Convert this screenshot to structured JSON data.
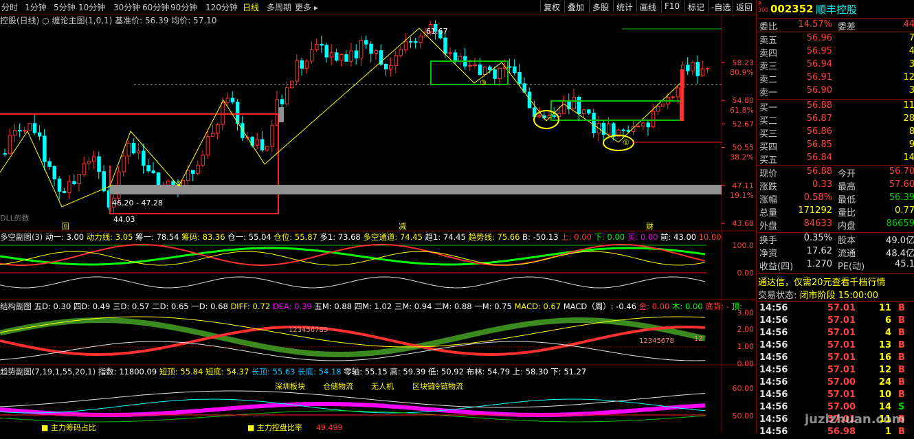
{
  "periods": [
    "分时",
    "1分钟",
    "5分钟",
    "10分钟",
    "30分钟",
    "60分钟",
    "90分钟",
    "120分钟",
    "日线",
    "多周期",
    "更多"
  ],
  "active_period": "日线",
  "toolbar": [
    "复权",
    "叠加",
    "多股",
    "统计",
    "画线",
    "F10",
    "标记",
    "-自选",
    "返回"
  ],
  "main_header": {
    "name": "控股(日线)",
    "indicator": "缠论主图(1,0,1)",
    "base_price": "基准价: 56.39",
    "avg_price": "均价: 57.10"
  },
  "price_axis": [
    {
      "price": "58.23",
      "pct": "80.9%"
    },
    {
      "price": "54.80",
      "pct": "61.8%"
    },
    {
      "price": "52.67",
      "pct": ""
    },
    {
      "price": "50.55",
      "pct": "38.2%"
    },
    {
      "price": "47.11",
      "pct": "19.1%"
    },
    {
      "price": "43.68",
      "pct": ""
    }
  ],
  "annotations": {
    "peak": "61.67",
    "low": "44.03",
    "zone": "46.20 - 47.28",
    "tag1": "回",
    "tag2": "减",
    "tag3": "财",
    "dll": "DLL的数",
    "pivot2": "②",
    "pivot3": "③",
    "pivot1": "①"
  },
  "sub1": {
    "title": "多空副图(3)",
    "values": [
      {
        "k": "动一",
        "v": "3.00",
        "c": "#ffffff"
      },
      {
        "k": "动力线",
        "v": "3.05",
        "c": "#ffff00"
      },
      {
        "k": "筹一",
        "v": "78.54",
        "c": "#ffffff"
      },
      {
        "k": "筹码",
        "v": "83.36",
        "c": "#ffff00"
      },
      {
        "k": "仓一",
        "v": "55.04",
        "c": "#ffffff"
      },
      {
        "k": "仓位",
        "v": "55.87",
        "c": "#ffff00"
      },
      {
        "k": "多1",
        "v": "73.68",
        "c": "#ffffff"
      },
      {
        "k": "多空通道",
        "v": "74.45",
        "c": "#ffff00"
      },
      {
        "k": "趋1",
        "v": "74.45",
        "c": "#ffffff"
      },
      {
        "k": "趋势线",
        "v": "75.66",
        "c": "#ffff00"
      },
      {
        "k": "B",
        "v": "-50.13",
        "c": "#ffffff"
      },
      {
        "k": "上",
        "v": "0.00",
        "c": "#ff4040"
      },
      {
        "k": "下",
        "v": "0.00",
        "c": "#00ff00"
      },
      {
        "k": "买",
        "v": "0.00",
        "c": "#ff00ff"
      },
      {
        "k": "前",
        "v": "43.00",
        "c": "#ffffff"
      },
      {
        "k": "",
        "v": "10.00",
        "c": "#ff4040"
      }
    ],
    "axis": [
      "100.0",
      "0.00"
    ]
  },
  "sub2": {
    "title": "结构副图",
    "values": [
      {
        "k": "五D",
        "v": "0.30",
        "c": "#ffffff"
      },
      {
        "k": "四D",
        "v": "0.49",
        "c": "#ffffff"
      },
      {
        "k": "三D",
        "v": "0.57",
        "c": "#ffffff"
      },
      {
        "k": "二D",
        "v": "0.65",
        "c": "#ffffff"
      },
      {
        "k": "一D",
        "v": "0.68",
        "c": "#ffffff"
      },
      {
        "k": "DIFF",
        "v": "0.72",
        "c": "#ffff00"
      },
      {
        "k": "DEA",
        "v": "0.39",
        "c": "#ff00ff"
      },
      {
        "k": "五M",
        "v": "0.88",
        "c": "#ffffff"
      },
      {
        "k": "四M",
        "v": "1.02",
        "c": "#ffffff"
      },
      {
        "k": "三M",
        "v": "0.94",
        "c": "#ffffff"
      },
      {
        "k": "二M",
        "v": "0.88",
        "c": "#ffffff"
      },
      {
        "k": "一M",
        "v": "0.75",
        "c": "#ffffff"
      },
      {
        "k": "MACD",
        "v": "0.67",
        "c": "#ffff00"
      },
      {
        "k": "MACD（周）",
        "v": "-0.46",
        "c": "#ffffff"
      },
      {
        "k": "金",
        "v": "0.00",
        "c": "#ff4040"
      },
      {
        "k": "木",
        "v": "0.00",
        "c": "#00ff00"
      },
      {
        "k": "底背",
        "v": "-",
        "c": "#ff4040"
      },
      {
        "k": "顶",
        "v": "",
        "c": "#00ff00"
      }
    ],
    "axis": [
      "3.00",
      "2.00",
      "1.00",
      "0.00"
    ],
    "seq1": "123456789",
    "seq2": "12345678",
    "seq3": "12"
  },
  "sub3": {
    "title": "趋势副图(7,19,1,55,20,1)",
    "values": [
      {
        "k": "指数",
        "v": "11800.09",
        "c": "#ffffff"
      },
      {
        "k": "短顶",
        "v": "55.84",
        "c": "#ffff00"
      },
      {
        "k": "短底",
        "v": "54.37",
        "c": "#ffff00"
      },
      {
        "k": "长顶",
        "v": "55.63",
        "c": "#00c0ff"
      },
      {
        "k": "长底",
        "v": "54.18",
        "c": "#00c0ff"
      },
      {
        "k": "零轴",
        "v": "55.15",
        "c": "#ffffff"
      },
      {
        "k": "高",
        "v": "59.39",
        "c": "#ffffff"
      },
      {
        "k": "低",
        "v": "50.92",
        "c": "#ffffff"
      },
      {
        "k": "布林",
        "v": "54.79",
        "c": "#ffffff"
      },
      {
        "k": "上",
        "v": "58.30",
        "c": "#ffffff"
      },
      {
        "k": "下",
        "v": "51.27",
        "c": "#ffffff"
      }
    ],
    "axis": [
      "60.00",
      "50.00"
    ],
    "labels": [
      "深圳板块",
      "仓储物流",
      "无人机",
      "区块链",
      "冷链物流"
    ],
    "bottom1": "主力筹码占比",
    "bottom2": "主力控盘比率",
    "bottom_val": "49.499"
  },
  "quote": {
    "code": "002352",
    "name": "顺丰控股",
    "badge": "R\n300",
    "weibi_label": "委比",
    "weibi_val": "14.57%",
    "weicha_label": "委差",
    "weicha_val": "44",
    "asks": [
      {
        "l": "卖五",
        "p": "56.96",
        "v": "7"
      },
      {
        "l": "卖四",
        "p": "56.95",
        "v": "4"
      },
      {
        "l": "卖三",
        "p": "56.94",
        "v": "3"
      },
      {
        "l": "卖二",
        "p": "56.91",
        "v": "12"
      },
      {
        "l": "卖一",
        "p": "56.90",
        "v": "3"
      }
    ],
    "bids": [
      {
        "l": "买一",
        "p": "56.88",
        "v": "11"
      },
      {
        "l": "买二",
        "p": "56.87",
        "v": "28"
      },
      {
        "l": "买三",
        "p": "56.86",
        "v": "8"
      },
      {
        "l": "买四",
        "p": "56.85",
        "v": "9"
      },
      {
        "l": "买五",
        "p": "56.84",
        "v": "14"
      }
    ],
    "stats": [
      {
        "l1": "现价",
        "v1": "56.88",
        "c1": "red",
        "l2": "今开",
        "v2": "56.70",
        "c2": "red"
      },
      {
        "l1": "涨跌",
        "v1": "0.33",
        "c1": "red",
        "l2": "最高",
        "v2": "57.60",
        "c2": "red"
      },
      {
        "l1": "涨幅",
        "v1": "0.58%",
        "c1": "red",
        "l2": "最低",
        "v2": "56.39",
        "c2": "grn"
      },
      {
        "l1": "总量",
        "v1": "171292",
        "c1": "yel",
        "l2": "量比",
        "v2": "0.77",
        "c2": "yel"
      },
      {
        "l1": "外盘",
        "v1": "84633",
        "c1": "red",
        "l2": "内盘",
        "v2": "86659",
        "c2": "grn"
      }
    ],
    "stats2": [
      {
        "l1": "换手",
        "v1": "0.35%",
        "c1": "wht",
        "l2": "股本",
        "v2": "49.0亿",
        "c2": "wht"
      },
      {
        "l1": "净资",
        "v1": "17.62",
        "c1": "wht",
        "l2": "流通",
        "v2": "48.4亿",
        "c2": "wht"
      },
      {
        "l1": "收益(四)",
        "v1": "1.270",
        "c1": "wht",
        "l2": "PE(动)",
        "v2": "45.1",
        "c2": "wht"
      }
    ],
    "ad": "通达信，仅需20元查看千档行情",
    "status_label": "交易状态:",
    "status_val": "闭市阶段 15:00:00",
    "ticks": [
      {
        "t": "14:56",
        "p": "57.01",
        "v": "11",
        "s": "B"
      },
      {
        "t": "14:56",
        "p": "57.01",
        "v": "6",
        "s": "B"
      },
      {
        "t": "14:56",
        "p": "57.01",
        "v": "4",
        "s": "B"
      },
      {
        "t": "14:56",
        "p": "57.01",
        "v": "13",
        "s": "B"
      },
      {
        "t": "14:56",
        "p": "57.01",
        "v": "16",
        "s": "B"
      },
      {
        "t": "14:56",
        "p": "57.01",
        "v": "12",
        "s": "B"
      },
      {
        "t": "14:56",
        "p": "57.00",
        "v": "24",
        "s": "B"
      },
      {
        "t": "14:56",
        "p": "57.01",
        "v": "10",
        "s": "B"
      },
      {
        "t": "14:56",
        "p": "57.00",
        "v": "14",
        "s": "S"
      },
      {
        "t": "14:56",
        "p": "57.01",
        "v": "11",
        "s": "B"
      },
      {
        "t": "14:56",
        "p": "56.98",
        "v": "1",
        "s": "B"
      }
    ]
  },
  "watermark": "juzizhuan.com",
  "colors": {
    "up": "#ff3232",
    "down": "#00ffff",
    "bg": "#000000",
    "grid": "#800000"
  }
}
